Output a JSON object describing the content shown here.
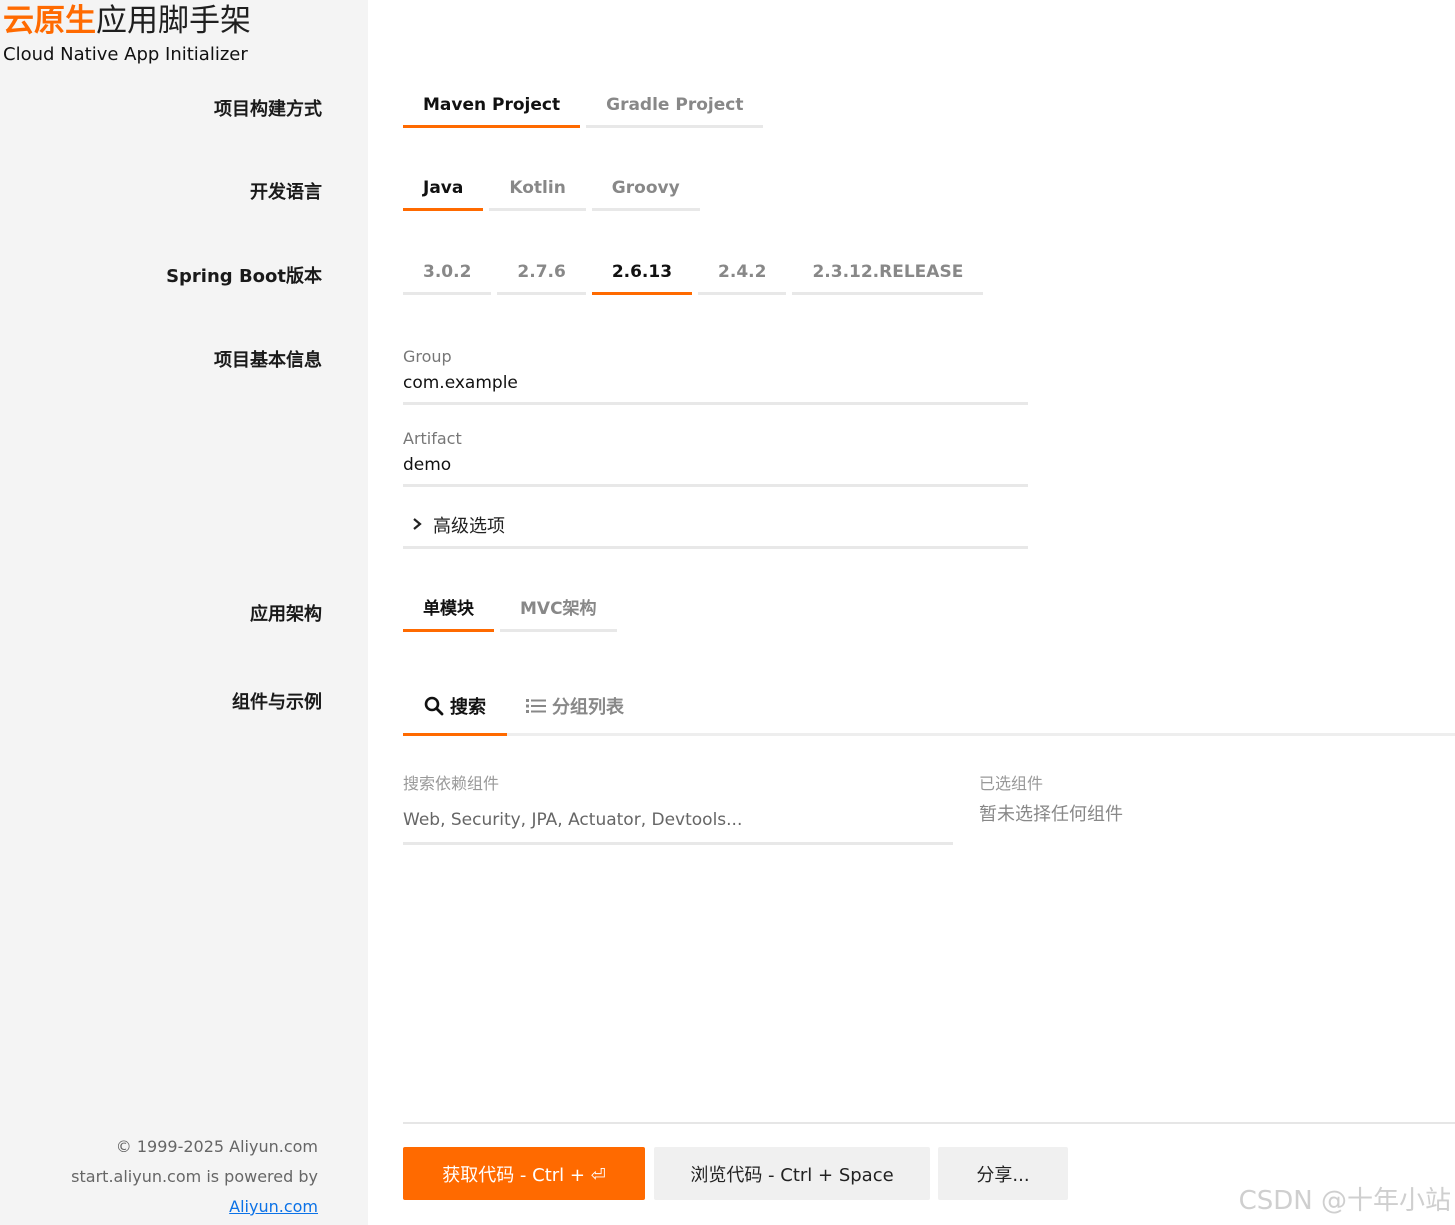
{
  "logo": {
    "title_accent": "云原生",
    "title_main": "应用脚手架",
    "subtitle": "Cloud Native App Initializer"
  },
  "labels": {
    "build_method": "项目构建方式",
    "language": "开发语言",
    "boot_version": "Spring Boot版本",
    "basic_info": "项目基本信息",
    "architecture": "应用架构",
    "components": "组件与示例"
  },
  "build_tabs": [
    "Maven Project",
    "Gradle Project"
  ],
  "language_tabs": [
    "Java",
    "Kotlin",
    "Groovy"
  ],
  "boot_tabs": [
    "3.0.2",
    "2.7.6",
    "2.6.13",
    "2.4.2",
    "2.3.12.RELEASE"
  ],
  "basic": {
    "group_label": "Group",
    "group_value": "com.example",
    "artifact_label": "Artifact",
    "artifact_value": "demo",
    "advanced": "高级选项"
  },
  "arch_tabs": [
    "单模块",
    "MVC架构"
  ],
  "components": {
    "tab_search": "搜索",
    "tab_list": "分组列表",
    "search_label": "搜索依赖组件",
    "search_placeholder": "Web, Security, JPA, Actuator, Devtools...",
    "selected_label": "已选组件",
    "selected_empty": "暂未选择任何组件"
  },
  "actions": {
    "get_code": "获取代码 - Ctrl + ⏎",
    "browse_code": "浏览代码 - Ctrl + Space",
    "share": "分享..."
  },
  "footer": {
    "copyright": "© 1999-2025 Aliyun.com",
    "powered": "start.aliyun.com is powered by",
    "link": "Aliyun.com"
  },
  "watermark": "CSDN @十年小站",
  "colors": {
    "accent": "#ff6a00",
    "sidebar_bg": "#f4f4f4",
    "link": "#0b72e7"
  }
}
